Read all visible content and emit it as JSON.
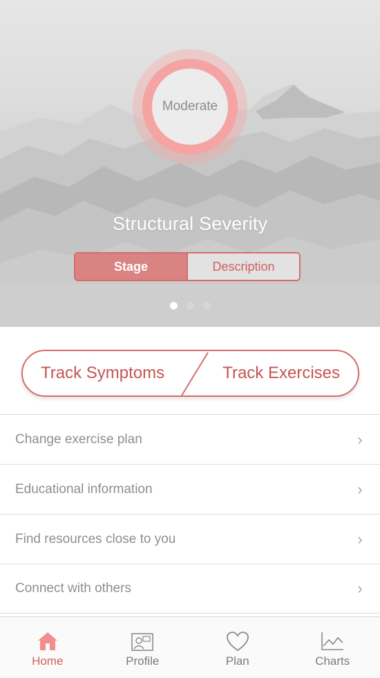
{
  "hero": {
    "severity_value": "Moderate",
    "title": "Structural Severity",
    "segments": [
      {
        "label": "Stage",
        "active": true
      },
      {
        "label": "Description",
        "active": false
      }
    ],
    "page_indicator": {
      "count": 3,
      "current": 1
    }
  },
  "track": {
    "symptoms_label": "Track Symptoms",
    "exercises_label": "Track Exercises"
  },
  "menu": [
    {
      "label": "Change exercise plan",
      "icon": "chevron-right-icon"
    },
    {
      "label": "Educational information",
      "icon": "chevron-right-icon"
    },
    {
      "label": "Find resources close to you",
      "icon": "chevron-right-icon"
    },
    {
      "label": "Connect with others",
      "icon": "chevron-right-icon"
    }
  ],
  "tabs": [
    {
      "label": "Home",
      "icon": "home-icon",
      "active": true
    },
    {
      "label": "Profile",
      "icon": "profile-icon",
      "active": false
    },
    {
      "label": "Plan",
      "icon": "heart-icon",
      "active": false
    },
    {
      "label": "Charts",
      "icon": "chart-icon",
      "active": false
    }
  ],
  "colors": {
    "accent": "#d25f5e",
    "ring": "#f5a3a3",
    "text_muted": "#8e8e8e"
  }
}
